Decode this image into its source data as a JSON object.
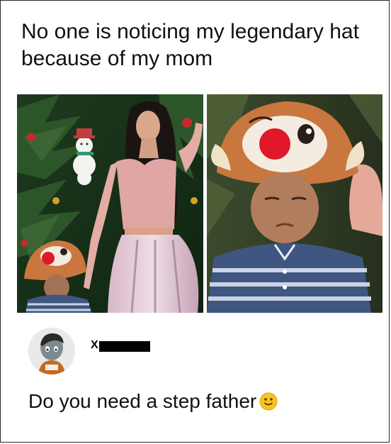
{
  "post": {
    "caption": "No one is noticing my legendary hat because of my mom"
  },
  "images": {
    "left": {
      "icon": "photo-woman-and-boy-with-chipmunk-hat"
    },
    "right": {
      "icon": "photo-boy-closeup-with-chipmunk-hat"
    }
  },
  "comment": {
    "username_visible": "X",
    "avatar_icon": "cartoon-avatar-icon",
    "text": "Do you need a step father",
    "emoji_icon": "smiley-face-icon"
  },
  "colors": {
    "hat_brown": "#c9773f",
    "hat_red": "#e0182a",
    "shirt_blue": "#3f5680",
    "outfit_pink": "#e0a6a3"
  }
}
